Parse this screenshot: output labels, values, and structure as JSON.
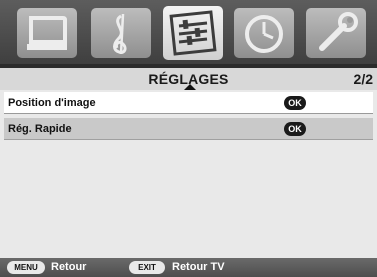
{
  "tabs": [
    {
      "name": "tv-picture-icon",
      "selected": false
    },
    {
      "name": "music-note-icon",
      "selected": false
    },
    {
      "name": "settings-sliders-icon",
      "selected": true
    },
    {
      "name": "clock-icon",
      "selected": false
    },
    {
      "name": "wrench-icon",
      "selected": false
    }
  ],
  "header": {
    "title": "RÉGLAGES",
    "page": "2/2"
  },
  "menu": {
    "items": [
      {
        "label": "Position d'image",
        "badge": "OK",
        "selected": true
      },
      {
        "label": "Rég. Rapide",
        "badge": "OK",
        "selected": false
      }
    ]
  },
  "footer": {
    "menu_key": "MENU",
    "menu_label": "Retour",
    "exit_key": "EXIT",
    "exit_label": "Retour TV"
  },
  "colors": {
    "background": "#e6e6e6",
    "selected_row": "#ffffff",
    "normal_row": "#c9c9c9",
    "icon_band": "#4a4a4a"
  }
}
